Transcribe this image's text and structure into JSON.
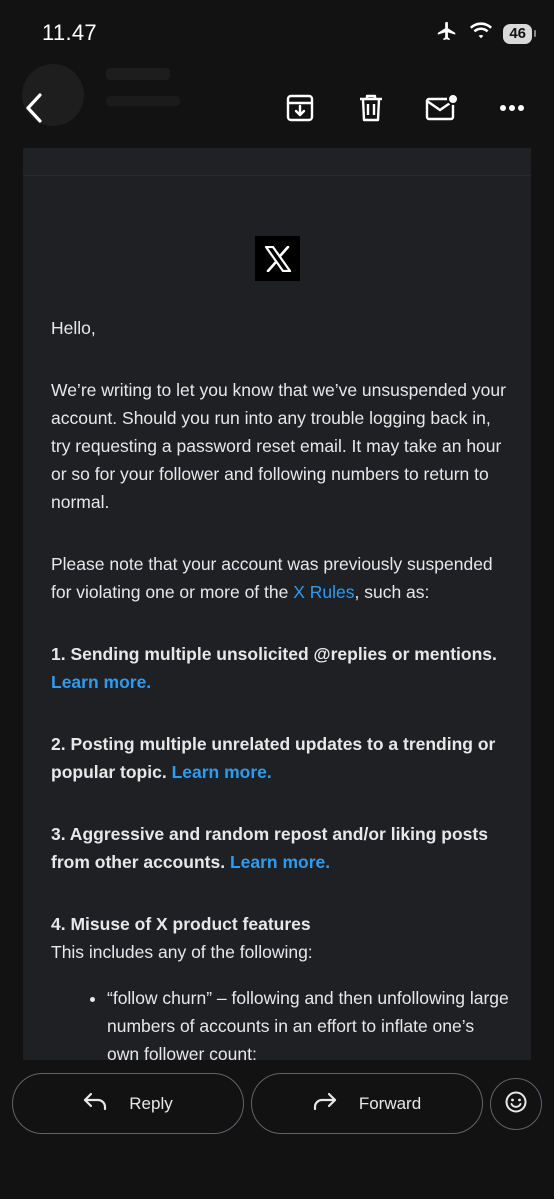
{
  "status_bar": {
    "time": "11.47",
    "battery_level": "46",
    "icons": [
      "airplane-icon",
      "wifi-icon",
      "battery-icon"
    ]
  },
  "toolbar": {
    "icons": [
      "back-arrow-icon",
      "archive-icon",
      "trash-icon",
      "mark-unread-icon",
      "more-icon"
    ]
  },
  "email": {
    "logo": "X",
    "greeting": "Hello,",
    "paragraph1": "We’re writing to let you know that we’ve unsuspended your account. Should you run into any trouble logging back in, try requesting a password reset email. It may take an hour or so for your follower and following numbers to return to normal.",
    "paragraph2_before": "Please note that your account was previously suspended for violating one or more of the ",
    "paragraph2_link": "X Rules",
    "paragraph2_after": ", such as:",
    "rules": [
      {
        "text": "1. Sending multiple unsolicited @replies or mentions.",
        "link": "Learn more."
      },
      {
        "text": "2. Posting multiple unrelated updates to a trending or popular topic.",
        "link": "Learn more."
      },
      {
        "text": "3. Aggressive and random repost and/or liking posts from other accounts.",
        "link": "Learn more."
      }
    ],
    "rule4_heading": "4. Misuse of X product features",
    "rule4_intro": "This includes any of the following:",
    "bullet1": "“follow churn” – following and then unfollowing large numbers of accounts in an effort to inflate one’s own follower count;"
  },
  "actions": {
    "reply_label": "Reply",
    "forward_label": "Forward"
  },
  "colors": {
    "background": "#121212",
    "card": "#202124",
    "link": "#2e9bf0"
  }
}
